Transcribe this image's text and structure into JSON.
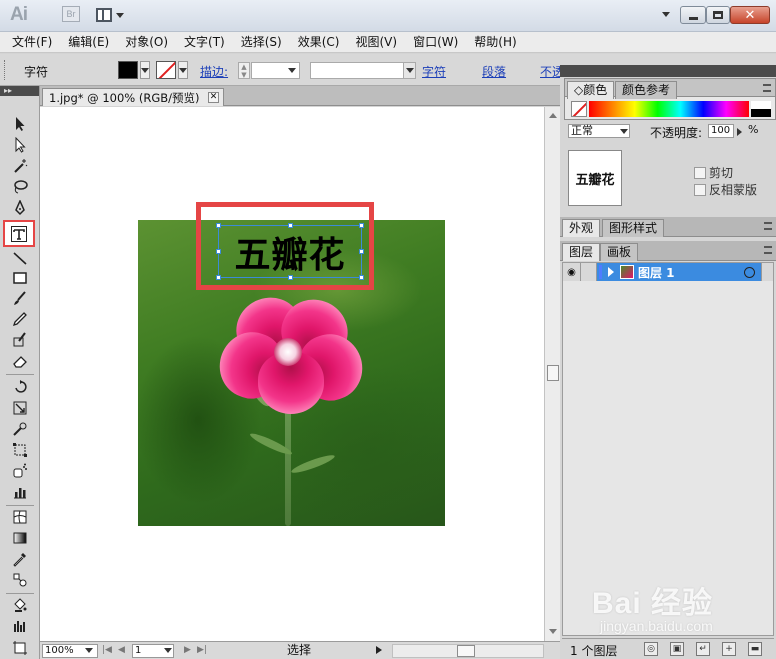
{
  "app": {
    "logo": "Ai",
    "bridge_label": "Br",
    "colors": {
      "accent": "#3b8be0",
      "highlight": "#e54545",
      "titlebar": "#d3dbe6"
    }
  },
  "menu": [
    "文件(F)",
    "编辑(E)",
    "对象(O)",
    "文字(T)",
    "选择(S)",
    "效果(C)",
    "视图(V)",
    "窗口(W)",
    "帮助(H)"
  ],
  "control": {
    "label": "字符",
    "stroke_link": "描边:",
    "character_link": "字符",
    "paragraph_link": "段落",
    "opacity_link": "不透"
  },
  "document": {
    "tab_title": "1.jpg* @ 100% (RGB/预览)",
    "tab_close": "✕",
    "text_object": "五瓣花",
    "zoom": "100%",
    "page": "1",
    "status": "选择"
  },
  "color_panel": {
    "tabs": [
      "颜色",
      "颜色参考"
    ]
  },
  "transparency": {
    "blend_mode": "正常",
    "opacity_label": "不透明度:",
    "opacity_value": "100",
    "opacity_unit": "%",
    "mask_thumb_text": "五瓣花",
    "clip_label": "剪切",
    "invert_label": "反相蒙版"
  },
  "appearance_tabs": [
    "外观",
    "图形样式"
  ],
  "layers": {
    "tabs": [
      "图层",
      "画板"
    ],
    "layer_name": "图层 1",
    "count": "1 个图层"
  },
  "watermark": {
    "logo": "Bai  经验",
    "sub": "jingyan.baidu.com"
  }
}
